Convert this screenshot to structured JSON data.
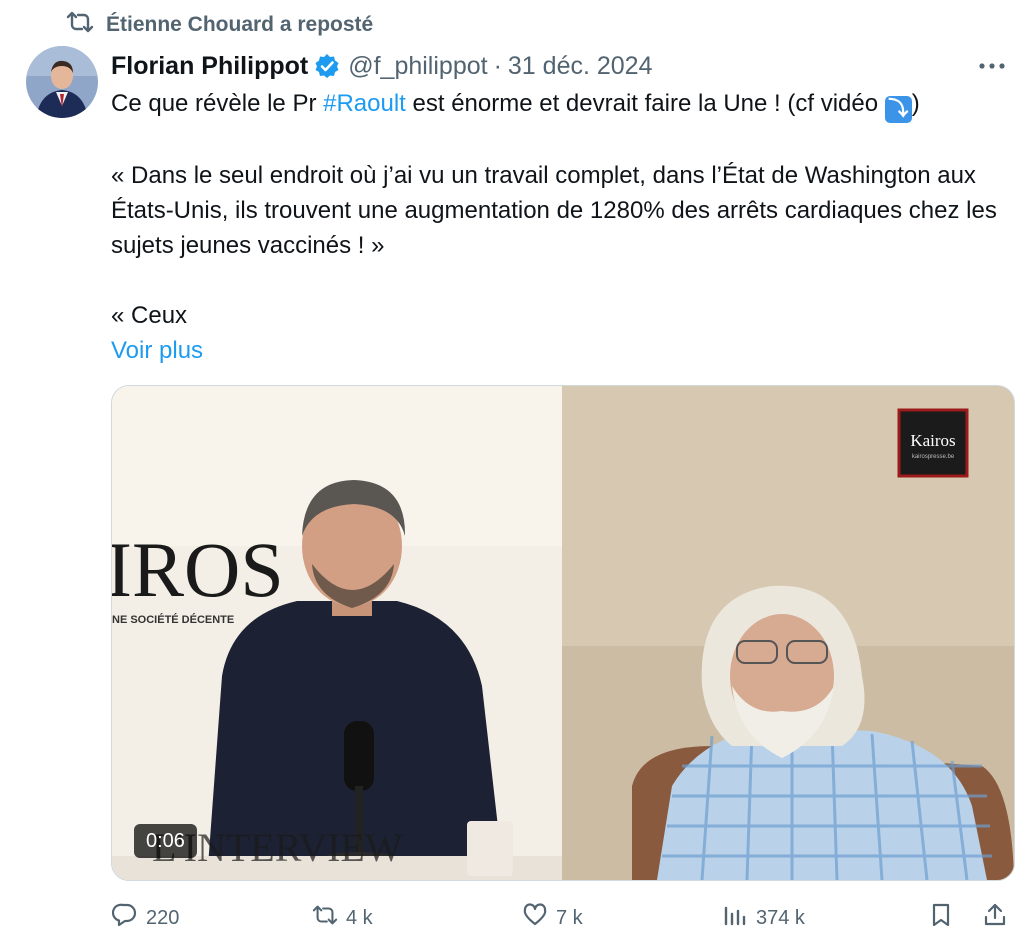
{
  "repost_banner": {
    "text": "Étienne Chouard a reposté",
    "icon": "repost-icon"
  },
  "author": {
    "name": "Florian Philippot",
    "verified": true,
    "handle": "@f_philippot",
    "separator": "·",
    "date": "31 déc. 2024"
  },
  "tweet": {
    "line1_before": "Ce que révèle le Pr ",
    "hashtag": "#Raoult",
    "line1_after": " est énorme et devrait faire la Une ! (cf vidéo ",
    "arrow_emoji": "⤵",
    "line1_close": ")",
    "quote": "« Dans le seul endroit où j’ai vu un travail complet, dans l’État de Washington aux États-Unis, ils trouvent une augmentation de 1280% des arrêts cardiaques chez les sujets jeunes vaccinés ! »",
    "quote_start": "« Ceux",
    "show_more": "Voir plus"
  },
  "video": {
    "duration": "0:06",
    "backdrop_text": "IROS",
    "backdrop_subtitle": "NE SOCIÉTÉ DÉCENTE",
    "watermark": "Kairos",
    "watermark_sub": "kairospresse.be",
    "lower_text": "L'INTERVIEW"
  },
  "actions": {
    "replies": "220",
    "reposts": "4 k",
    "likes": "7 k",
    "views": "374 k"
  },
  "colors": {
    "link": "#1d9bf0",
    "muted": "#536471",
    "text": "#0f1419"
  }
}
